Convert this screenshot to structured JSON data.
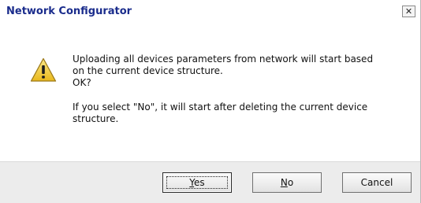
{
  "window": {
    "title": "Network Configurator",
    "close_glyph": "✕"
  },
  "icon": {
    "name": "warning-icon",
    "fill_color": "#f3d33a",
    "stroke_color": "#a07a10"
  },
  "message": {
    "line1": "Uploading all devices parameters from network will start based\non the current device structure.\nOK?",
    "line2": "If you select \"No\", it will start after deleting the current device\nstructure."
  },
  "buttons": {
    "yes": {
      "accel": "Y",
      "rest": "es"
    },
    "no": {
      "accel": "N",
      "rest": "o"
    },
    "cancel": {
      "label": "Cancel"
    }
  }
}
